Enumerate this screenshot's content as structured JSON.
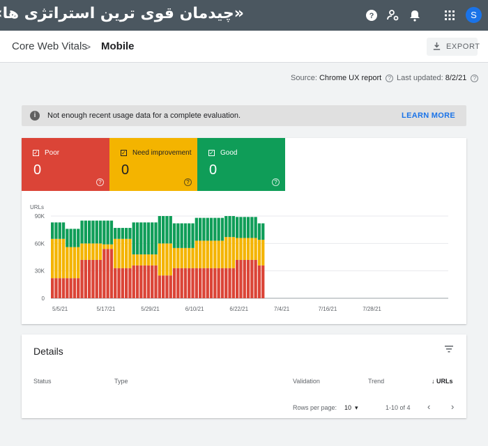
{
  "topbar": {
    "title": "«چیدمان قوی ترین استراتژی ها»",
    "avatar_letter": "S",
    "icons": [
      "help-icon",
      "manage-accounts-icon",
      "notifications-icon",
      "apps-icon"
    ]
  },
  "header": {
    "breadcrumb_parent": "Core Web Vitals",
    "separator": ">",
    "breadcrumb_current": "Mobile",
    "export_label": "EXPORT"
  },
  "meta": {
    "source_label": "Source:",
    "source_value": "Chrome UX report",
    "updated_label": "Last updated:",
    "updated_value": "8/2/21"
  },
  "banner": {
    "text": "Not enough recent usage data for a complete evaluation.",
    "link": "LEARN MORE"
  },
  "summary": {
    "poor": {
      "label": "Poor",
      "value": "0",
      "color": "#db4437"
    },
    "needs": {
      "label": "Need improvement",
      "value": "0",
      "color": "#f4b400"
    },
    "good": {
      "label": "Good",
      "value": "0",
      "color": "#0f9d58"
    }
  },
  "chart_data": {
    "type": "bar",
    "stacked": true,
    "ylabel": "URLs",
    "y_ticks": [
      "0",
      "30K",
      "60K",
      "90K"
    ],
    "ylim": [
      0,
      90000
    ],
    "x_ticks": [
      "5/5/21",
      "5/17/21",
      "5/29/21",
      "6/10/21",
      "6/22/21",
      "7/4/21",
      "7/16/21",
      "7/28/21"
    ],
    "grid": true,
    "series": [
      {
        "color": "#db4437",
        "values": [
          22000,
          22000,
          22000,
          22000,
          22000,
          22000,
          22000,
          22000,
          42000,
          42000,
          42000,
          42000,
          42000,
          42000,
          54000,
          54000,
          54000,
          33000,
          33000,
          33000,
          33000,
          33000,
          36000,
          36000,
          36000,
          36000,
          36000,
          36000,
          36000,
          25000,
          25000,
          25000,
          25000,
          33000,
          33000,
          33000,
          33000,
          33000,
          33000,
          33000,
          33000,
          33000,
          33000,
          33000,
          33000,
          33000,
          33000,
          33000,
          33000,
          33000,
          42000,
          42000,
          42000,
          42000,
          42000,
          42000,
          36000,
          36000
        ]
      },
      {
        "color": "#f4b400",
        "values": [
          43000,
          43000,
          43000,
          43000,
          34000,
          34000,
          34000,
          34000,
          18000,
          18000,
          18000,
          18000,
          18000,
          18000,
          5000,
          5000,
          5000,
          32000,
          32000,
          32000,
          32000,
          32000,
          12000,
          12000,
          12000,
          12000,
          12000,
          12000,
          12000,
          35000,
          35000,
          35000,
          35000,
          22000,
          22000,
          22000,
          22000,
          22000,
          22000,
          30000,
          30000,
          30000,
          30000,
          30000,
          30000,
          30000,
          30000,
          34000,
          34000,
          34000,
          24000,
          24000,
          24000,
          24000,
          24000,
          24000,
          28000,
          28000
        ]
      },
      {
        "color": "#0f9d58",
        "values": [
          18000,
          18000,
          18000,
          18000,
          20000,
          20000,
          20000,
          20000,
          25000,
          25000,
          25000,
          25000,
          25000,
          25000,
          26000,
          26000,
          26000,
          12000,
          12000,
          12000,
          12000,
          12000,
          35000,
          35000,
          35000,
          35000,
          35000,
          35000,
          35000,
          30000,
          30000,
          30000,
          30000,
          27000,
          27000,
          27000,
          27000,
          27000,
          27000,
          25000,
          25000,
          25000,
          25000,
          25000,
          25000,
          25000,
          25000,
          23000,
          23000,
          23000,
          23000,
          23000,
          23000,
          23000,
          23000,
          23000,
          18000,
          18000
        ]
      }
    ]
  },
  "details": {
    "title": "Details",
    "columns": [
      "Status",
      "Type",
      "Validation",
      "Trend",
      "URLs"
    ],
    "rows_per_page_label": "Rows per page:",
    "rows_per_page_value": "10",
    "range": "1-10 of 4"
  }
}
